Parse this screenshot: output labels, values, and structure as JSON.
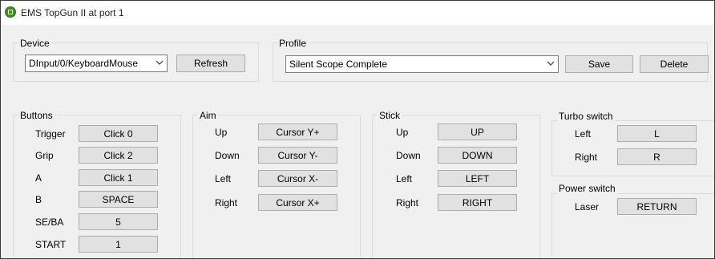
{
  "window": {
    "title": "EMS TopGun II at port 1"
  },
  "device": {
    "group_label": "Device",
    "selected": "DInput/0/KeyboardMouse",
    "refresh_label": "Refresh"
  },
  "profile": {
    "group_label": "Profile",
    "selected": "Silent Scope Complete",
    "save_label": "Save",
    "delete_label": "Delete"
  },
  "buttons": {
    "group_label": "Buttons",
    "rows": [
      {
        "label": "Trigger",
        "value": "Click 0"
      },
      {
        "label": "Grip",
        "value": "Click 2"
      },
      {
        "label": "A",
        "value": "Click 1"
      },
      {
        "label": "B",
        "value": "SPACE"
      },
      {
        "label": "SE/BA",
        "value": "5"
      },
      {
        "label": "START",
        "value": "1"
      }
    ]
  },
  "aim": {
    "group_label": "Aim",
    "rows": [
      {
        "label": "Up",
        "value": "Cursor Y+"
      },
      {
        "label": "Down",
        "value": "Cursor Y-"
      },
      {
        "label": "Left",
        "value": "Cursor X-"
      },
      {
        "label": "Right",
        "value": "Cursor X+"
      }
    ]
  },
  "stick": {
    "group_label": "Stick",
    "rows": [
      {
        "label": "Up",
        "value": "UP"
      },
      {
        "label": "Down",
        "value": "DOWN"
      },
      {
        "label": "Left",
        "value": "LEFT"
      },
      {
        "label": "Right",
        "value": "RIGHT"
      }
    ]
  },
  "turbo": {
    "group_label": "Turbo switch",
    "rows": [
      {
        "label": "Left",
        "value": "L"
      },
      {
        "label": "Right",
        "value": "R"
      }
    ]
  },
  "power": {
    "group_label": "Power switch",
    "rows": [
      {
        "label": "Laser",
        "value": "RETURN"
      }
    ]
  }
}
